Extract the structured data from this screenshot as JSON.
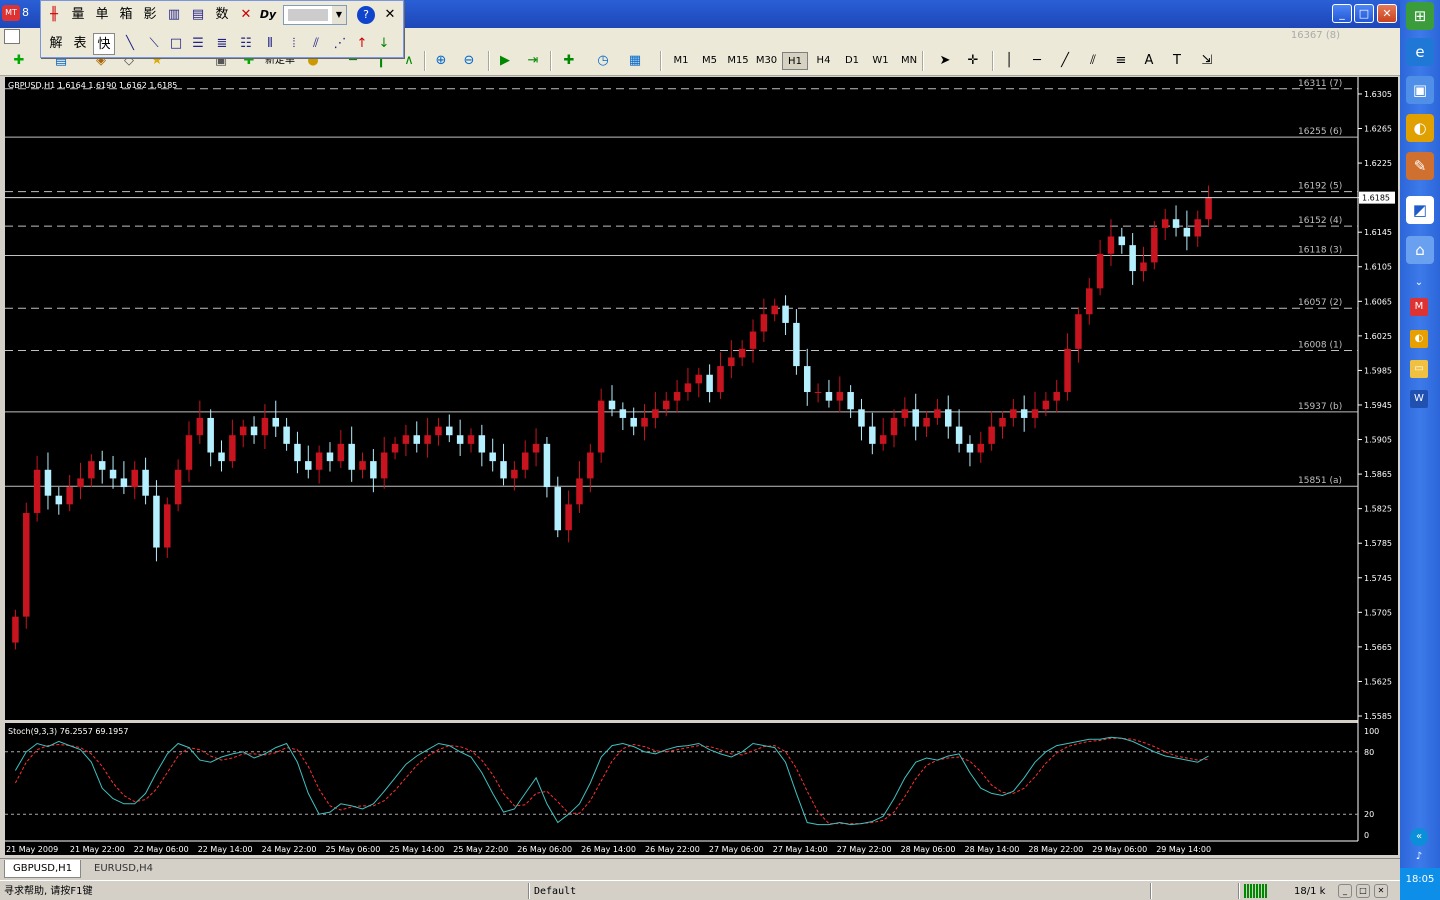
{
  "window": {
    "title": "8",
    "mdi_title": "16367 (8)"
  },
  "floating_toolbar": {
    "row1": [
      "量",
      "单",
      "箱",
      "影",
      "数"
    ],
    "row2": [
      "解",
      "表",
      "快"
    ]
  },
  "toolbar": {
    "timeframes": [
      "M1",
      "M5",
      "M15",
      "M30",
      "H1",
      "H4",
      "D1",
      "W1",
      "MN"
    ],
    "active_timeframe": "H1",
    "new_order_label": "新定单"
  },
  "chart": {
    "symbol_info": "GBPUSD,H1  1.6164 1.6190 1.6162 1.6185",
    "current_price": "1.6185",
    "indicator_label": "Stoch(9,3,3) 76.2557 69.1957",
    "osc_levels": [
      "100",
      "80",
      "20",
      "0"
    ],
    "colors": {
      "background": "#000000",
      "bull": "#c8141e",
      "bear": "#b4f0ff",
      "grid": "#c0c0c0",
      "stoch_main": "#40c0c0",
      "stoch_signal": "#ff3030"
    }
  },
  "chart_data": {
    "type": "candlestick",
    "ylim": [
      1.5585,
      1.632
    ],
    "price_ticks": [
      "1.6305",
      "1.6265",
      "1.6225",
      "1.6185",
      "1.6145",
      "1.6105",
      "1.6065",
      "1.6025",
      "1.5985",
      "1.5945",
      "1.5905",
      "1.5865",
      "1.5825",
      "1.5785",
      "1.5745",
      "1.5705",
      "1.5665",
      "1.5625",
      "1.5585"
    ],
    "time_labels": [
      "21 May 2009",
      "21 May 22:00",
      "22 May 06:00",
      "22 May 14:00",
      "24 May 22:00",
      "25 May 06:00",
      "25 May 14:00",
      "25 May 22:00",
      "26 May 06:00",
      "26 May 14:00",
      "26 May 22:00",
      "27 May 06:00",
      "27 May 14:00",
      "27 May 22:00",
      "28 May 06:00",
      "28 May 14:00",
      "28 May 22:00",
      "29 May 06:00",
      "29 May 14:00"
    ],
    "levels": [
      {
        "label": "16311 (7)",
        "price": 1.6311,
        "style": "dashed"
      },
      {
        "label": "16255 (6)",
        "price": 1.6255,
        "style": "solid"
      },
      {
        "label": "16192 (5)",
        "price": 1.6192,
        "style": "dashed"
      },
      {
        "label": "16152 (4)",
        "price": 1.6152,
        "style": "dashed"
      },
      {
        "label": "16118 (3)",
        "price": 1.6118,
        "style": "solid"
      },
      {
        "label": "16057 (2)",
        "price": 1.6057,
        "style": "dashed"
      },
      {
        "label": "16008 (1)",
        "price": 1.6008,
        "style": "dashed"
      },
      {
        "label": "15937 (b)",
        "price": 1.5937,
        "style": "solid"
      },
      {
        "label": "15851 (a)",
        "price": 1.5851,
        "style": "solid"
      }
    ],
    "closes": [
      1.57,
      1.582,
      1.587,
      1.584,
      1.583,
      1.585,
      1.586,
      1.588,
      1.587,
      1.586,
      1.585,
      1.587,
      1.584,
      1.578,
      1.583,
      1.587,
      1.591,
      1.593,
      1.589,
      1.588,
      1.591,
      1.592,
      1.591,
      1.593,
      1.592,
      1.59,
      1.588,
      1.587,
      1.589,
      1.588,
      1.59,
      1.587,
      1.588,
      1.586,
      1.589,
      1.59,
      1.591,
      1.59,
      1.591,
      1.592,
      1.591,
      1.59,
      1.591,
      1.589,
      1.588,
      1.586,
      1.587,
      1.589,
      1.59,
      1.585,
      1.58,
      1.583,
      1.586,
      1.589,
      1.595,
      1.594,
      1.593,
      1.592,
      1.593,
      1.594,
      1.595,
      1.596,
      1.597,
      1.598,
      1.596,
      1.599,
      1.6,
      1.601,
      1.603,
      1.605,
      1.606,
      1.604,
      1.599,
      1.596,
      1.596,
      1.595,
      1.596,
      1.594,
      1.592,
      1.59,
      1.591,
      1.593,
      1.594,
      1.592,
      1.593,
      1.594,
      1.592,
      1.59,
      1.589,
      1.59,
      1.592,
      1.593,
      1.594,
      1.593,
      1.594,
      1.595,
      1.596,
      1.601,
      1.605,
      1.608,
      1.612,
      1.614,
      1.613,
      1.61,
      1.611,
      1.615,
      1.616,
      1.615,
      1.614,
      1.616,
      1.6185
    ],
    "stoch_main": [
      62,
      80,
      88,
      85,
      90,
      86,
      82,
      70,
      45,
      35,
      30,
      30,
      40,
      60,
      78,
      88,
      84,
      72,
      70,
      75,
      78,
      80,
      74,
      78,
      84,
      88,
      70,
      40,
      20,
      22,
      30,
      28,
      25,
      30,
      42,
      55,
      68,
      76,
      82,
      88,
      86,
      80,
      75,
      60,
      40,
      22,
      25,
      40,
      55,
      30,
      12,
      20,
      30,
      50,
      75,
      86,
      88,
      85,
      80,
      78,
      82,
      85,
      86,
      88,
      82,
      78,
      75,
      80,
      88,
      86,
      84,
      70,
      40,
      12,
      10,
      10,
      12,
      10,
      11,
      13,
      18,
      35,
      55,
      70,
      74,
      72,
      76,
      78,
      60,
      45,
      40,
      38,
      42,
      55,
      70,
      80,
      86,
      88,
      90,
      92,
      92,
      94,
      93,
      90,
      85,
      80,
      76,
      74,
      72,
      70,
      76
    ],
    "stoch_signal": [
      50,
      70,
      82,
      86,
      87,
      86,
      84,
      78,
      66,
      50,
      38,
      32,
      34,
      44,
      60,
      76,
      84,
      82,
      76,
      72,
      74,
      78,
      78,
      77,
      79,
      84,
      82,
      66,
      44,
      28,
      24,
      27,
      28,
      28,
      33,
      43,
      55,
      67,
      76,
      82,
      86,
      85,
      81,
      72,
      58,
      40,
      28,
      29,
      40,
      42,
      32,
      21,
      21,
      33,
      52,
      71,
      83,
      87,
      85,
      81,
      80,
      82,
      84,
      86,
      85,
      82,
      78,
      77,
      81,
      85,
      86,
      80,
      64,
      42,
      22,
      11,
      11,
      11,
      11,
      12,
      14,
      22,
      37,
      54,
      67,
      72,
      74,
      75,
      71,
      61,
      48,
      41,
      40,
      45,
      56,
      69,
      79,
      85,
      88,
      90,
      91,
      93,
      93,
      92,
      89,
      85,
      80,
      76,
      74,
      72,
      73
    ]
  },
  "tabs": [
    {
      "label": "GBPUSD,H1",
      "active": true
    },
    {
      "label": "EURUSD,H4",
      "active": false
    }
  ],
  "status": {
    "help": "寻求帮助, 请按F1键",
    "profile": "Default",
    "connection": "18/1 k"
  },
  "clock": "18:05"
}
